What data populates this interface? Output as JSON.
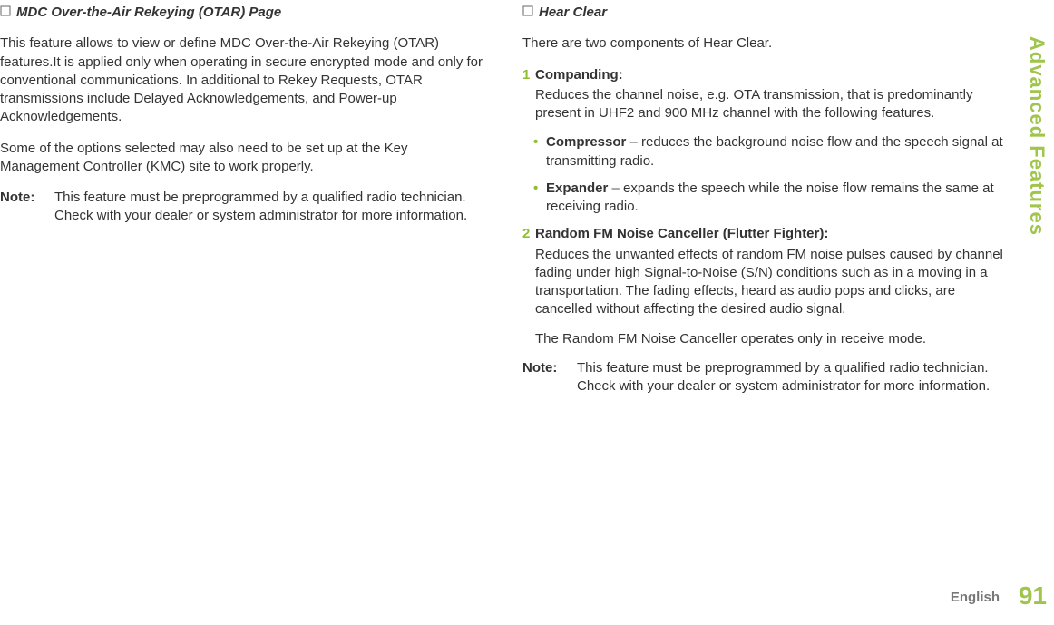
{
  "sideTab": "Advanced Features",
  "pageNum": "91",
  "lang": "English",
  "left": {
    "title": "MDC Over-the-Air Rekeying (OTAR) Page",
    "p1": "This feature allows to view or define MDC Over-the-Air Rekeying (OTAR) features.It is applied only when operating in secure encrypted mode and only for conventional communications. In additional to Rekey Requests, OTAR transmissions include Delayed Acknowledgements, and Power-up Acknowledgements.",
    "p2": "Some of the options selected may also need to be set up at the Key Management Controller (KMC) site to work properly.",
    "noteLabel": "Note:",
    "noteBody": "This feature must be preprogrammed by a qualified radio technician. Check with your dealer or system administrator for more information."
  },
  "right": {
    "title": "Hear Clear",
    "intro": "There are two components of Hear Clear.",
    "items": [
      {
        "num": "1",
        "title": "Companding:",
        "body": "Reduces the channel noise, e.g. OTA transmission, that is predominantly present in UHF2 and 900 MHz channel with the following features.",
        "bullets": [
          {
            "label": "Compressor",
            "dash": " – ",
            "text": "reduces the background noise flow and the speech signal at transmitting radio."
          },
          {
            "label": "Expander",
            "dash": " – ",
            "text": "expands the speech while the noise flow remains the same at receiving radio."
          }
        ]
      },
      {
        "num": "2",
        "title": "Random FM Noise Canceller (Flutter Fighter):",
        "body": "Reduces the unwanted effects of random FM noise pulses caused by channel fading under high Signal-to-Noise (S/N) conditions such as in a moving in a transportation. The fading effects, heard as audio pops and clicks, are cancelled without affecting the desired audio signal.",
        "tail": "The Random FM Noise Canceller operates only in receive mode."
      }
    ],
    "noteLabel": "Note:",
    "noteBody": "This feature must be preprogrammed by a qualified radio technician. Check with your dealer or system administrator for more information."
  }
}
